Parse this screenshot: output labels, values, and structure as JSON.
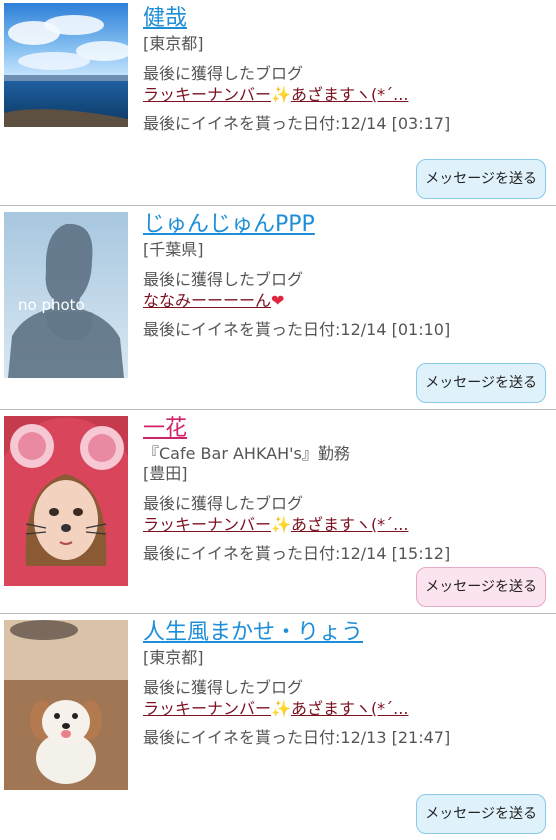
{
  "users": [
    {
      "name": "健哉",
      "location": "[東京都]",
      "blog_label": "最後に獲得したブログ",
      "blog_pre": "ラッキーナンバー",
      "blog_icon": "sparkle",
      "blog_post": "あざますヽ(*´...",
      "date_label": "最後にイイネを貰った日付:12/14 [03:17]",
      "button": "メッセージを送る",
      "theme": "blue",
      "photo_desc": "seaside-sky"
    },
    {
      "name": "じゅんじゅんPPP",
      "location": "[千葉県]",
      "blog_label": "最後に獲得したブログ",
      "blog_pre": "ななみーーーーん",
      "blog_icon": "heart",
      "blog_post": "",
      "date_label": "最後にイイネを貰った日付:12/14 [01:10]",
      "button": "メッセージを送る",
      "theme": "blue",
      "photo_desc": "no photo",
      "placeholder_text": "no photo"
    },
    {
      "name": "一花",
      "job": "『Cafe Bar AHKAH's』勤務",
      "location": "[豊田]",
      "blog_label": "最後に獲得したブログ",
      "blog_pre": "ラッキーナンバー",
      "blog_icon": "sparkle",
      "blog_post": "あざますヽ(*´...",
      "date_label": "最後にイイネを貰った日付:12/14 [15:12]",
      "button": "メッセージを送る",
      "theme": "pink",
      "photo_desc": "girl-with-mouse-ears"
    },
    {
      "name": "人生風まかせ・りょう",
      "location": "[東京都]",
      "blog_label": "最後に獲得したブログ",
      "blog_pre": "ラッキーナンバー",
      "blog_icon": "sparkle",
      "blog_post": "あざますヽ(*´...",
      "date_label": "最後にイイネを貰った日付:12/13 [21:47]",
      "button": "メッセージを送る",
      "theme": "blue",
      "photo_desc": "small-dog"
    }
  ],
  "colors": {
    "name_blue": "#1e8ed8",
    "name_pink": "#d0226c",
    "blog_link": "#7a1020",
    "button_blue_bg": "#dff2fb",
    "button_pink_bg": "#fbe3ef"
  }
}
